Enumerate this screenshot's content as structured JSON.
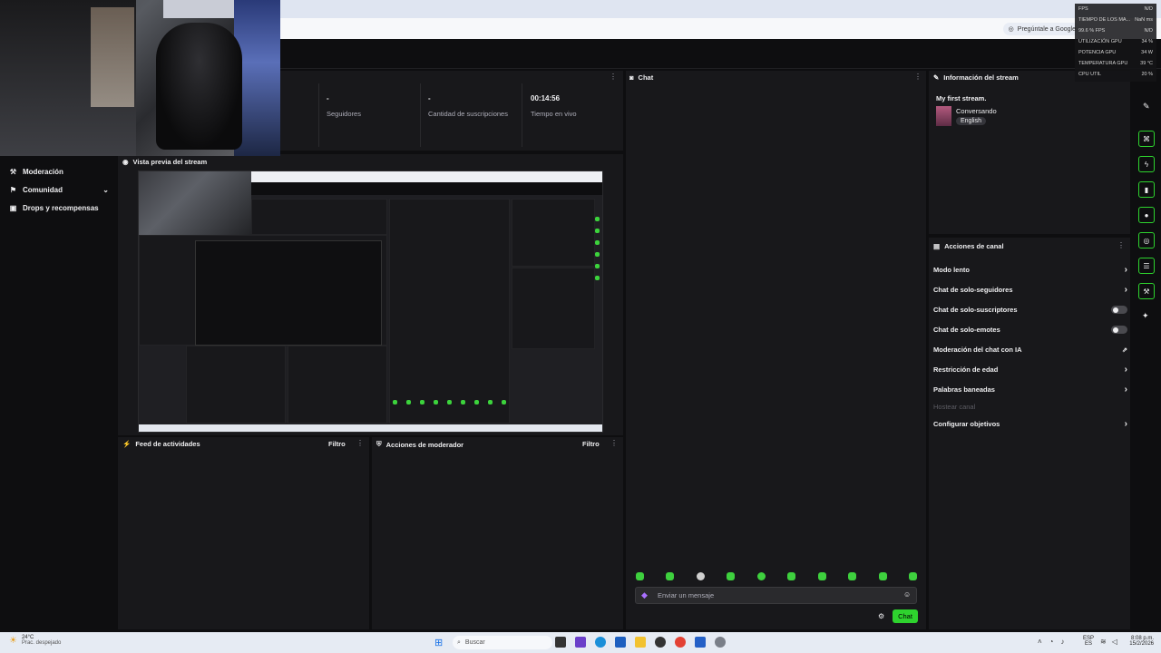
{
  "browser": {
    "google_pill": "Pregúntale a Google"
  },
  "overlay_stats": [
    {
      "label": "FPS",
      "value": "N/D"
    },
    {
      "label": "TIEMPO DE LOS MA...",
      "value": "NaN ms"
    },
    {
      "label": "99.6 % FPS",
      "value": "N/D"
    },
    {
      "label": "UTILIZACIÓN GPU",
      "value": "34 %"
    },
    {
      "label": "POTENCIA GPU",
      "value": "34 W"
    },
    {
      "label": "TEMPERATURA GPU",
      "value": "39 °C"
    },
    {
      "label": "CPU UTIL",
      "value": "20 %"
    }
  ],
  "sidebar": {
    "items": [
      {
        "label": "Moderación",
        "icon": "wrench-icon"
      },
      {
        "label": "Comunidad",
        "icon": "community-icon"
      },
      {
        "label": "Drops y recompensas",
        "icon": "gift-icon"
      }
    ]
  },
  "stats": [
    {
      "value": "-",
      "label": "Seguidores"
    },
    {
      "value": "-",
      "label": "Cantidad de suscripciones"
    },
    {
      "value": "00:14:56",
      "label": "Tiempo en vivo"
    }
  ],
  "preview": {
    "title": "Vista previa del stream"
  },
  "activity_feed": {
    "title": "Feed de actividades",
    "filter": "Filtro"
  },
  "mod_actions": {
    "title": "Acciones de moderador",
    "filter": "Filtro"
  },
  "chat": {
    "title": "Chat",
    "placeholder": "Enviar un mensaje",
    "send_label": "Chat"
  },
  "stream_info": {
    "title": "Información del stream",
    "stream_title": "My first stream.",
    "category": "Conversando",
    "tag": "English"
  },
  "channel_actions": {
    "title": "Acciones de canal",
    "items": [
      {
        "label": "Modo lento",
        "control": "chevron"
      },
      {
        "label": "Chat de solo-seguidores",
        "control": "chevron"
      },
      {
        "label": "Chat de solo-suscriptores",
        "control": "toggle"
      },
      {
        "label": "Chat de solo-emotes",
        "control": "toggle"
      },
      {
        "label": "Moderación del chat con IA",
        "control": "external"
      },
      {
        "label": "Restricción de edad",
        "control": "chevron"
      },
      {
        "label": "Palabras baneadas",
        "control": "chevron"
      },
      {
        "label": "Hostear canal",
        "control": "none"
      },
      {
        "label": "Configurar objetivos",
        "control": "chevron"
      }
    ]
  },
  "taskbar": {
    "weather_temp": "24°C",
    "weather_desc": "Prac. despejado",
    "search_placeholder": "Buscar",
    "lang_top": "ESP",
    "lang_bottom": "ES",
    "time": "8:08 p.m.",
    "date": "15/2/2026"
  },
  "colors": {
    "accent_green": "#2ed32e",
    "panel_bg": "#18181b",
    "page_bg": "#0e0e10"
  }
}
